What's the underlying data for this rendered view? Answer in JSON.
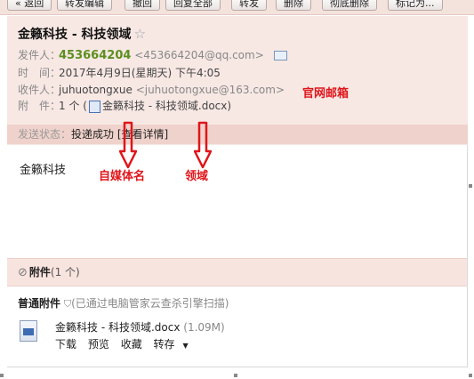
{
  "toolbar": {
    "buttons": [
      "« 返回",
      "转发编辑",
      "撤回",
      "回复全部",
      "转发",
      "删除",
      "彻底删除",
      "标记为..."
    ]
  },
  "email": {
    "subject": "金籁科技 - 科技领域",
    "from_label": "发件人：",
    "from_name": "453664204",
    "from_addr": "<453664204@qq.com>",
    "time_label": "时　间：",
    "time_value": "2017年4月9日(星期天) 下午4:05",
    "to_label": "收件人：",
    "to_name": "juhuotongxue",
    "to_addr": "<juhuotongxue@163.com>",
    "attach_label": "附　件：",
    "attach_prefix": "1 个 (",
    "attach_file": "金籁科技 - 科技领域.docx",
    "attach_suffix": ")",
    "status_label": "发送状态：",
    "status_value": "投递成功",
    "status_link": "[查看详情]",
    "body": "金籁科技"
  },
  "annotations": {
    "official_email": "官网邮箱",
    "media_name": "自媒体名",
    "domain": "领域"
  },
  "attachments": {
    "title": "附件",
    "count": "(1 个)",
    "section_label": "普通附件",
    "scan_note": "(已通过电脑管家云查杀引擎扫描)",
    "file_name": "金籁科技 - 科技领域.docx",
    "file_size": "(1.09M)",
    "actions": [
      "下载",
      "预览",
      "收藏",
      "转存"
    ]
  },
  "colors": {
    "header_bg": "#f7e8e4",
    "status_bg": "#efd2cb",
    "sender_green": "#5b8f1f",
    "annotation_red": "#e0151b"
  }
}
